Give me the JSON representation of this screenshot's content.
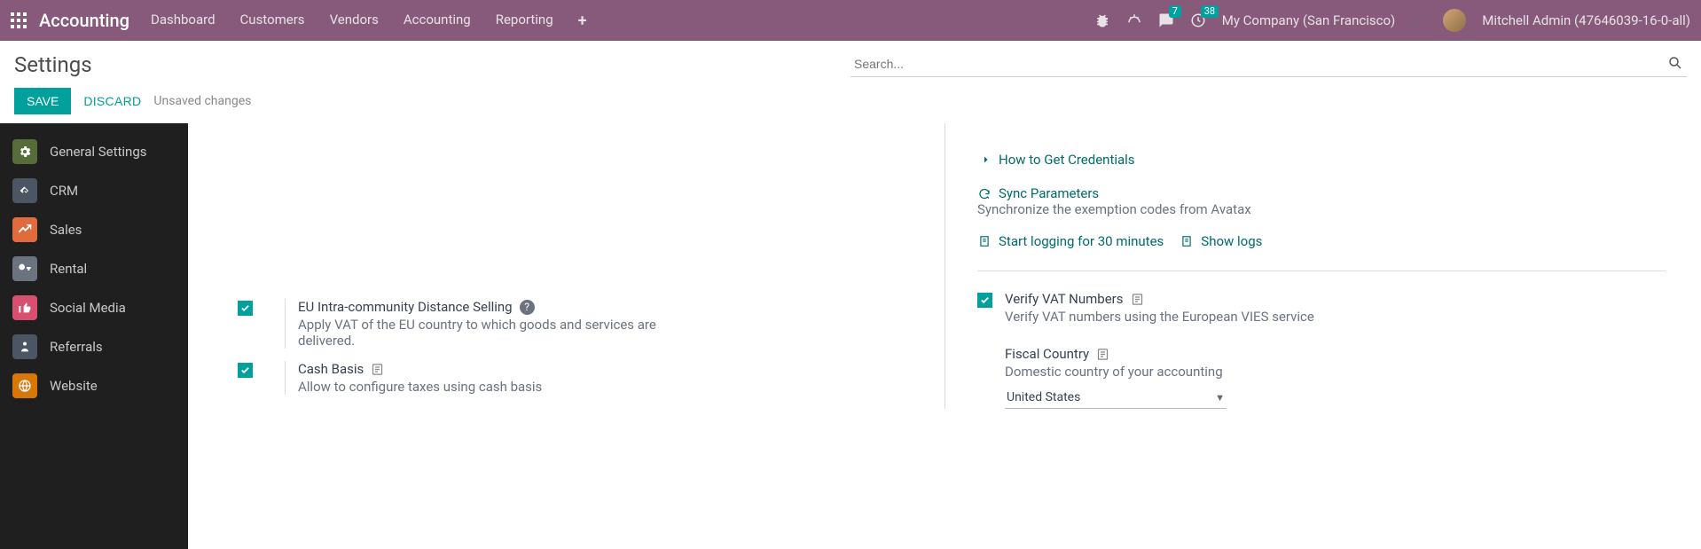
{
  "topbar": {
    "brand": "Accounting",
    "nav": [
      "Dashboard",
      "Customers",
      "Vendors",
      "Accounting",
      "Reporting"
    ],
    "messages_badge": "7",
    "activities_badge": "38",
    "company": "My Company (San Francisco)",
    "username": "Mitchell Admin (47646039-16-0-all)"
  },
  "cp": {
    "title": "Settings",
    "search_placeholder": "Search...",
    "save": "SAVE",
    "discard": "DISCARD",
    "dirty": "Unsaved changes"
  },
  "sidebar": {
    "items": [
      {
        "label": "General Settings",
        "cls": "ic-general"
      },
      {
        "label": "CRM",
        "cls": "ic-crm"
      },
      {
        "label": "Sales",
        "cls": "ic-sales"
      },
      {
        "label": "Rental",
        "cls": "ic-rental"
      },
      {
        "label": "Social Media",
        "cls": "ic-social"
      },
      {
        "label": "Referrals",
        "cls": "ic-referral"
      },
      {
        "label": "Website",
        "cls": "ic-website"
      }
    ]
  },
  "right_top": {
    "credentials": "How to Get Credentials",
    "sync_title": "Sync Parameters",
    "sync_desc": "Synchronize the exemption codes from Avatax",
    "start_log": "Start logging for 30 minutes",
    "show_logs": "Show logs"
  },
  "left_settings": {
    "eu": {
      "title": "EU Intra-community Distance Selling",
      "desc": "Apply VAT of the EU country to which goods and services are delivered."
    },
    "cash": {
      "title": "Cash Basis",
      "desc": "Allow to configure taxes using cash basis"
    }
  },
  "right_settings": {
    "vat": {
      "title": "Verify VAT Numbers",
      "desc": "Verify VAT numbers using the European VIES service"
    },
    "fiscal": {
      "title": "Fiscal Country",
      "desc": "Domestic country of your accounting",
      "value": "United States"
    }
  }
}
